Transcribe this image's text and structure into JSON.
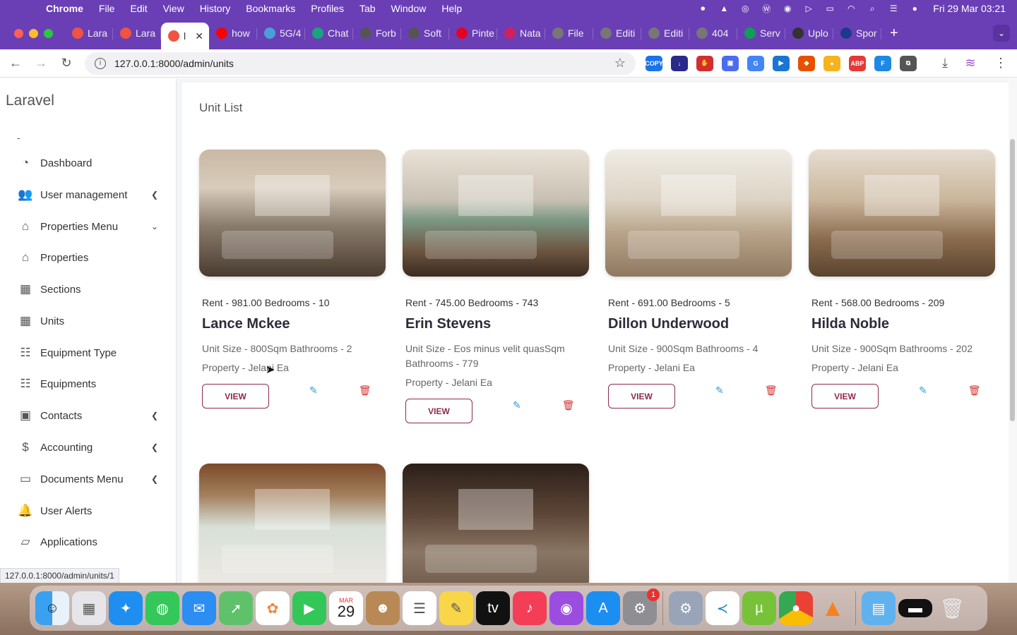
{
  "menubar": {
    "app_name": "Chrome",
    "items": [
      "File",
      "Edit",
      "View",
      "History",
      "Bookmarks",
      "Profiles",
      "Tab",
      "Window",
      "Help"
    ],
    "clock": "Fri 29 Mar  03:21"
  },
  "tabs": [
    {
      "label": "Lara",
      "icon": "laravel-icon",
      "color": "#f05340"
    },
    {
      "label": "Lara",
      "icon": "laravel-icon",
      "color": "#f05340"
    },
    {
      "label": "l",
      "icon": "laravel-icon",
      "color": "#f05340",
      "active": true
    },
    {
      "label": "how",
      "icon": "youtube-icon",
      "color": "#ff0000"
    },
    {
      "label": "5G/4",
      "icon": "web-icon",
      "color": "#4a9fd8"
    },
    {
      "label": "Chat",
      "icon": "chatgpt-icon",
      "color": "#19a37f"
    },
    {
      "label": "Forb",
      "icon": "forbes-icon",
      "color": "#555555"
    },
    {
      "label": "Soft",
      "icon": "soft-icon",
      "color": "#555555"
    },
    {
      "label": "Pinte",
      "icon": "pinterest-icon",
      "color": "#e60023"
    },
    {
      "label": "Nata",
      "icon": "nata-icon",
      "color": "#d02060"
    },
    {
      "label": "File",
      "icon": "file-icon",
      "color": "#777777"
    },
    {
      "label": "Editi",
      "icon": "globe-icon",
      "color": "#777777"
    },
    {
      "label": "Editi",
      "icon": "globe-icon",
      "color": "#777777"
    },
    {
      "label": "404",
      "icon": "globe-icon",
      "color": "#777777"
    },
    {
      "label": "Serv",
      "icon": "sheets-icon",
      "color": "#0f9d58"
    },
    {
      "label": "Uplo",
      "icon": "upload-icon",
      "color": "#333333"
    },
    {
      "label": "Spor",
      "icon": "sp-icon",
      "color": "#1b3a8c"
    }
  ],
  "toolbar": {
    "url": "127.0.0.1:8000/admin/units",
    "extensions": [
      {
        "name": "copy-ext-icon",
        "label": "COPY",
        "color": "#1a73e8"
      },
      {
        "name": "download-ext-icon",
        "label": "↓",
        "color": "#2a2a8a"
      },
      {
        "name": "hand-ext-icon",
        "label": "✋",
        "color": "#d32f2f"
      },
      {
        "name": "save-ext-icon",
        "label": "▣",
        "color": "#4a6cf0"
      },
      {
        "name": "translate-ext-icon",
        "label": "G",
        "color": "#4285f4"
      },
      {
        "name": "play-ext-icon",
        "label": "▶",
        "color": "#1976d2"
      },
      {
        "name": "flame-ext-icon",
        "label": "◆",
        "color": "#e65100"
      },
      {
        "name": "coin-ext-icon",
        "label": "●",
        "color": "#f6b31c"
      },
      {
        "name": "abp-ext-icon",
        "label": "ABP",
        "color": "#e53935"
      },
      {
        "name": "font-ext-icon",
        "label": "F",
        "color": "#1e88e5"
      },
      {
        "name": "puzzle-ext-icon",
        "label": "⧉",
        "color": "#555555"
      }
    ]
  },
  "sidebar": {
    "brand": "Laravel",
    "dash": "-",
    "items": [
      {
        "label": "Dashboard",
        "icon": "gauge-icon",
        "arrow": ""
      },
      {
        "label": "User management",
        "icon": "users-icon",
        "arrow": "left"
      },
      {
        "label": "Properties Menu",
        "icon": "home-icon",
        "arrow": "down"
      },
      {
        "label": "Properties",
        "icon": "home-icon",
        "arrow": ""
      },
      {
        "label": "Sections",
        "icon": "building-icon",
        "arrow": ""
      },
      {
        "label": "Units",
        "icon": "building-icon",
        "arrow": ""
      },
      {
        "label": "Equipment Type",
        "icon": "server-icon",
        "arrow": ""
      },
      {
        "label": "Equipments",
        "icon": "server-icon",
        "arrow": ""
      },
      {
        "label": "Contacts",
        "icon": "contact-icon",
        "arrow": "left"
      },
      {
        "label": "Accounting",
        "icon": "dollar-icon",
        "arrow": "left"
      },
      {
        "label": "Documents Menu",
        "icon": "folder-icon",
        "arrow": "left"
      },
      {
        "label": "User Alerts",
        "icon": "bell-icon",
        "arrow": ""
      },
      {
        "label": "Applications",
        "icon": "folder-open-icon",
        "arrow": ""
      }
    ]
  },
  "main": {
    "title": "Unit List",
    "view_label": "VIEW",
    "units": [
      {
        "meta": "Rent - 981.00 Bedrooms - 10",
        "name": "Lance Mckee",
        "size": "Unit Size - 800Sqm Bathrooms - 2",
        "property": "Property - Jelani Ea",
        "photo": "bedroom-photo"
      },
      {
        "meta": "Rent - 745.00 Bedrooms - 743",
        "name": "Erin Stevens",
        "size": "Unit Size - Eos minus velit quasSqm Bathrooms - 779",
        "property": "Property - Jelani Ea",
        "photo": "bedroom-patio-photo"
      },
      {
        "meta": "Rent - 691.00 Bedrooms - 5",
        "name": "Dillon Underwood",
        "size": "Unit Size - 900Sqm Bathrooms - 4",
        "property": "Property - Jelani Ea",
        "photo": "living-room-photo"
      },
      {
        "meta": "Rent - 568.00 Bedrooms - 209",
        "name": "Hilda Noble",
        "size": "Unit Size - 900Sqm Bathrooms - 202",
        "property": "Property - Jelani Ea",
        "photo": "open-plan-photo"
      },
      {
        "photo": "kitchen-dining-photo"
      },
      {
        "photo": "lounge-photo"
      }
    ]
  },
  "status_url": "127.0.0.1:8000/admin/units/1",
  "dock": {
    "calendar_month": "MAR",
    "calendar_day": "29",
    "settings_badge": "1"
  }
}
